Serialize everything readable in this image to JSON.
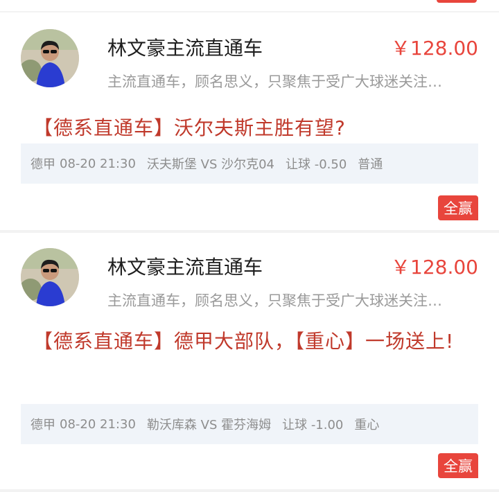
{
  "colors": {
    "accent": "#e8453c",
    "headline": "#c0392b",
    "match_bg": "#f0f4f9",
    "muted": "#9a9a9a"
  },
  "posts": [
    {
      "author": "林文豪主流直通车",
      "price": "￥128.00",
      "description": "主流直通车，顾名思义，只聚焦于受广大球迷关注…",
      "headline": "【德系直通车】沃尔夫斯主胜有望?",
      "match": {
        "league": "德甲",
        "time": "08-20 21:30",
        "teams": "沃夫斯堡 VS 沙尔克04",
        "handicap": "让球 -0.50",
        "level": "普通"
      },
      "result": "全赢",
      "avatar_icon": "user-avatar"
    },
    {
      "author": "林文豪主流直通车",
      "price": "￥128.00",
      "description": "主流直通车，顾名思义，只聚焦于受广大球迷关注…",
      "headline": "【德系直通车】德甲大部队，【重心】一场送上!",
      "match": {
        "league": "德甲",
        "time": "08-20 21:30",
        "teams": "勒沃库森 VS 霍芬海姆",
        "handicap": "让球 -1.00",
        "level": "重心"
      },
      "result": "全赢",
      "avatar_icon": "user-avatar"
    }
  ]
}
